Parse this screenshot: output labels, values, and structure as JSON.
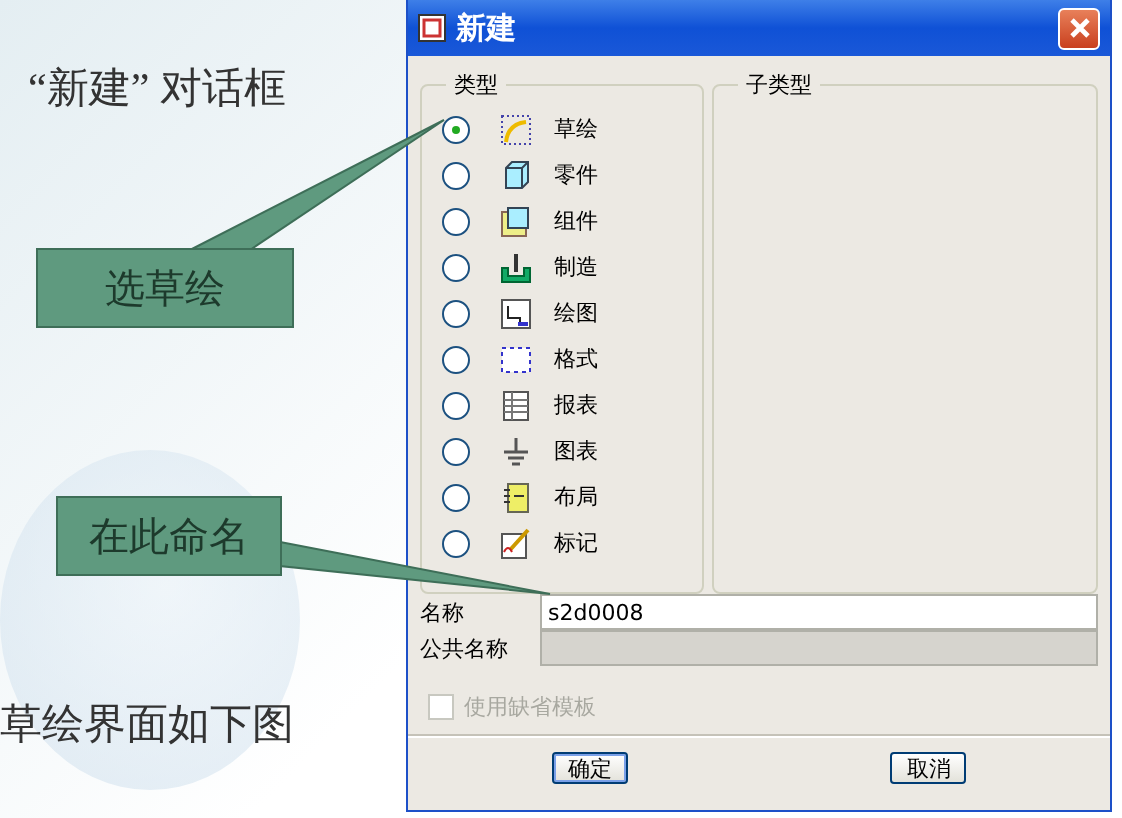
{
  "slide": {
    "heading": "“新建” 对话框",
    "callouts": [
      {
        "text": "选草绘"
      },
      {
        "text": "在此命名"
      }
    ],
    "caption": "草绘界面如下图"
  },
  "dialog": {
    "title": "新建",
    "type_group": {
      "label": "类型",
      "options": [
        {
          "label": "草绘",
          "kind": "sketch",
          "selected": true
        },
        {
          "label": "零件",
          "kind": "part",
          "selected": false
        },
        {
          "label": "组件",
          "kind": "assembly",
          "selected": false
        },
        {
          "label": "制造",
          "kind": "manufacturing",
          "selected": false
        },
        {
          "label": "绘图",
          "kind": "drawing",
          "selected": false
        },
        {
          "label": "格式",
          "kind": "format",
          "selected": false
        },
        {
          "label": "报表",
          "kind": "report",
          "selected": false
        },
        {
          "label": "图表",
          "kind": "diagram",
          "selected": false
        },
        {
          "label": "布局",
          "kind": "layout",
          "selected": false
        },
        {
          "label": "标记",
          "kind": "markup",
          "selected": false
        }
      ]
    },
    "subtype_group": {
      "label": "子类型"
    },
    "name_field": {
      "label": "名称",
      "value": "s2d0008"
    },
    "common_name_field": {
      "label": "公共名称",
      "disabled": true
    },
    "use_template": {
      "label": "使用缺省模板",
      "checked": false,
      "disabled": true
    },
    "buttons": [
      "确定",
      "取消"
    ]
  }
}
